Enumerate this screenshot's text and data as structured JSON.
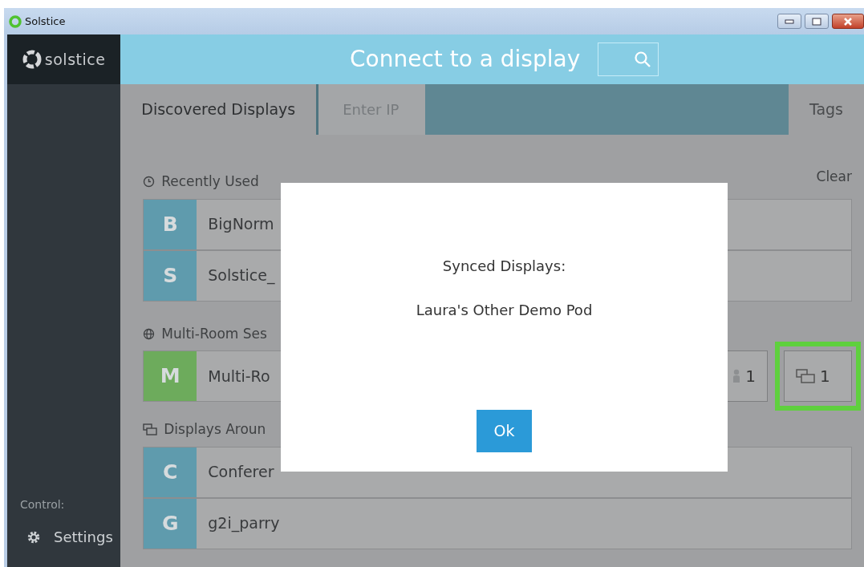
{
  "window": {
    "title": "Solstice"
  },
  "sidebar": {
    "logo": "solstice",
    "control_label": "Control:",
    "items": [
      {
        "label": "Settings"
      }
    ]
  },
  "header": {
    "title": "Connect to a display"
  },
  "tabs": [
    {
      "label": "Discovered Displays",
      "selected": true
    },
    {
      "label": "Tags",
      "selected": false
    }
  ],
  "ip_field": {
    "placeholder": "Enter IP"
  },
  "sections": [
    {
      "kind": "recent",
      "title": "Recently Used",
      "action": "Clear",
      "items": [
        {
          "letter": "B",
          "name": "BigNorm",
          "color": "#5f9bad"
        },
        {
          "letter": "S",
          "name": "Solstice_",
          "color": "#5f9bad"
        }
      ]
    },
    {
      "kind": "multiroom",
      "title": "Multi-Room Ses",
      "items": [
        {
          "letter": "M",
          "name": "Multi-Ro",
          "color": "#6dab5c",
          "users": "1",
          "displays": "1",
          "highlighted": true
        }
      ]
    },
    {
      "kind": "nearby",
      "title": "Displays Aroun",
      "items": [
        {
          "letter": "C",
          "name": "Conferer",
          "color": "#5f9bad"
        },
        {
          "letter": "G",
          "name": "g2i_parry",
          "color": "#5f9bad"
        }
      ]
    }
  ],
  "dialog": {
    "title": "Synced Displays:",
    "message": "Laura's Other Demo Pod",
    "button": "Ok"
  }
}
